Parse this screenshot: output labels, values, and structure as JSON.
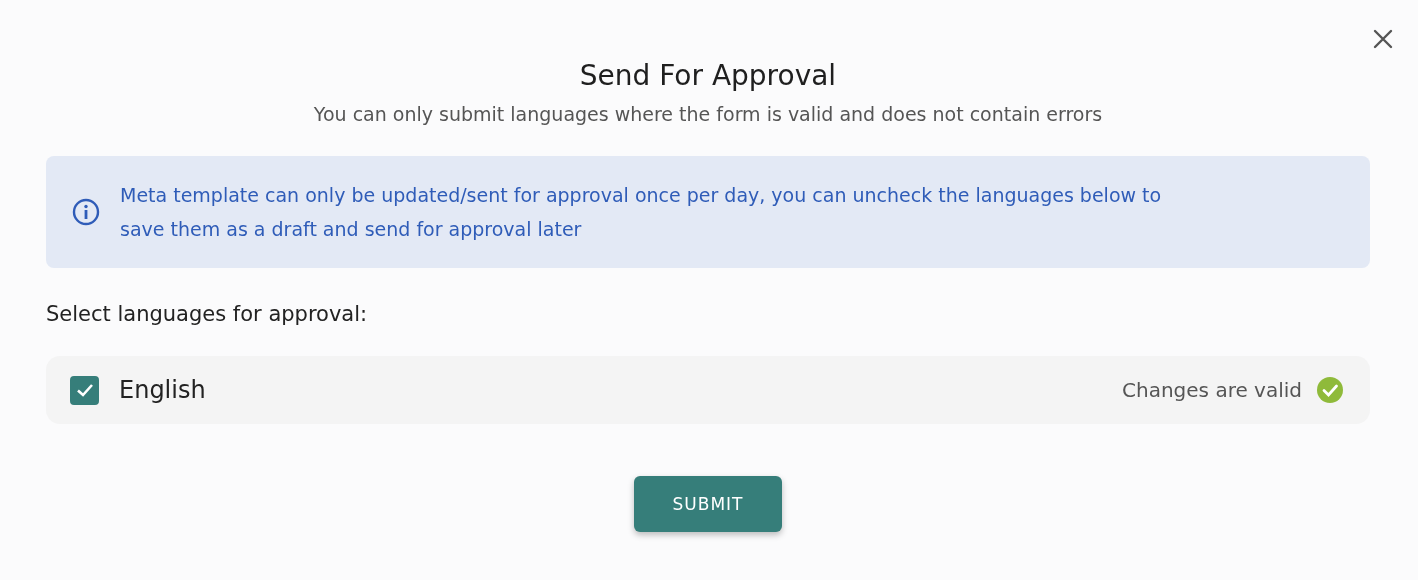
{
  "dialog": {
    "title": "Send For Approval",
    "subtitle": "You can only submit languages where the form is valid and does not contain errors",
    "info": "Meta template can only be updated/sent for approval once per day, you can uncheck the languages below to save them as a draft and send for approval later",
    "section_label": "Select languages for approval:",
    "languages": [
      {
        "name": "English",
        "checked": true,
        "status": "Changes are valid",
        "valid": true
      }
    ],
    "submit": "SUBMIT"
  }
}
